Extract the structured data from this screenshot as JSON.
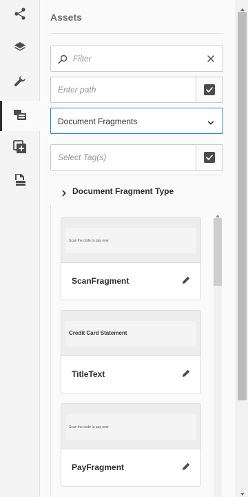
{
  "rail": {
    "items": [
      {
        "icon": "share-icon",
        "active": false
      },
      {
        "icon": "layers-icon",
        "active": false
      },
      {
        "icon": "wrench-icon",
        "active": false
      },
      {
        "icon": "assets-icon",
        "active": true
      },
      {
        "icon": "add-fragment-icon",
        "active": false
      },
      {
        "icon": "document-stack-icon",
        "active": false
      }
    ]
  },
  "panel": {
    "title": "Assets",
    "filter": {
      "placeholder": "Filter"
    },
    "path": {
      "placeholder": "Enter path"
    },
    "type_select": {
      "value": "Document Fragments"
    },
    "tags": {
      "placeholder": "Select Tag(s)"
    },
    "accordion": {
      "label": "Document Fragment Type"
    }
  },
  "cards": [
    {
      "name": "ScanFragment",
      "preview": "Scan the code to pay now"
    },
    {
      "name": "TitleText",
      "preview": "Credit Card Statement"
    },
    {
      "name": "PayFragment",
      "preview": "Scan the code to pay now"
    }
  ]
}
